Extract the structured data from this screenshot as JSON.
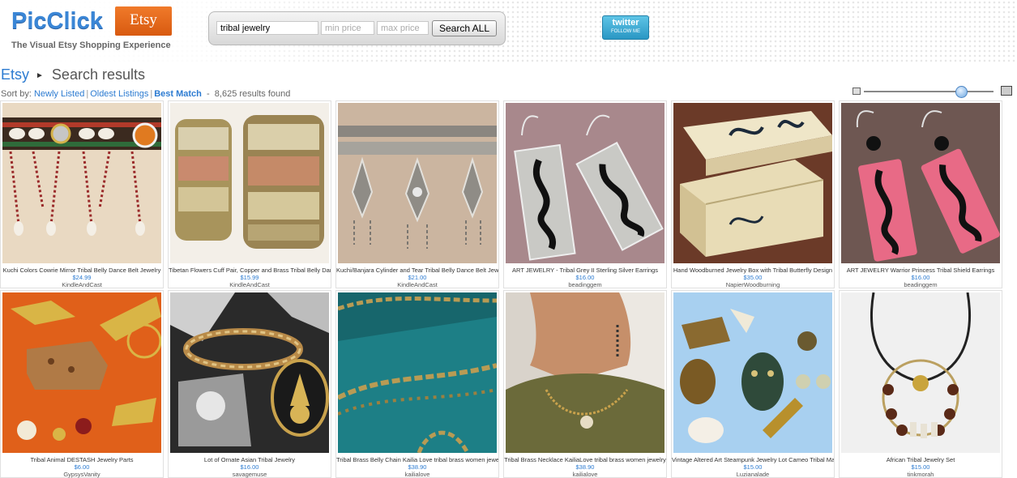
{
  "header": {
    "logo_text": "PicClick",
    "logo_badge": "Etsy",
    "tagline": "The Visual Etsy Shopping Experience",
    "twitter_top": "twitter",
    "twitter_bottom": "FOLLOW ME"
  },
  "search": {
    "query": "tribal jewelry",
    "min_price_placeholder": "min price",
    "max_price_placeholder": "max price",
    "button_label": "Search ALL"
  },
  "breadcrumb": {
    "root": "Etsy",
    "separator_icon": "triangle-right-icon",
    "current": "Search results"
  },
  "sort": {
    "label": "Sort by:",
    "newly_listed": "Newly Listed",
    "oldest_listings": "Oldest Listings",
    "best_match": "Best Match",
    "results": "8,625 results found"
  },
  "zoom": {
    "level": 0.72
  },
  "colors": {
    "link": "#2c7bd1",
    "brand_orange": "#e06a1a",
    "logo_blue": "#3a86d6"
  },
  "listings": [
    {
      "title": "Kuchi Colors Cowrie Mirror Tribal Belly Dance Belt Jewelry",
      "price": "$24.99",
      "shop": "KindleAndCast"
    },
    {
      "title": "Tibetan Flowers Cuff Pair, Copper and Brass Tribal Belly Dance",
      "price": "$15.99",
      "shop": "KindleAndCast"
    },
    {
      "title": "Kuchi/Banjara Cylinder and Tear Tribal Belly Dance Belt Jewelry",
      "price": "$21.00",
      "shop": "KindleAndCast"
    },
    {
      "title": "ART JEWELRY - Tribal Grey II Sterling Silver Earrings",
      "price": "$16.00",
      "shop": "beadinggem"
    },
    {
      "title": "Hand Woodburned Jewelry Box with Tribal Butterfly Design",
      "price": "$35.00",
      "shop": "NapierWoodburning"
    },
    {
      "title": "ART JEWELRY Warrior Princess Tribal Shield Earrings",
      "price": "$16.00",
      "shop": "beadinggem"
    },
    {
      "title": "Tribal Animal DESTASH Jewelry Parts",
      "price": "$6.00",
      "shop": "GypsysVanity"
    },
    {
      "title": "Lot of Ornate Asian Tribal Jewelry",
      "price": "$16.00",
      "shop": "savagemuse"
    },
    {
      "title": "Tribal Brass Belly Chain Kailia Love tribal brass women jewelry",
      "price": "$38.90",
      "shop": "kailialove"
    },
    {
      "title": "Tribal Brass Necklace KailiaLove tribal brass women jewelry",
      "price": "$38.90",
      "shop": "kailialove"
    },
    {
      "title": "Vintage Altered Art Steampunk Jewelry Lot Cameo Tribal Mask",
      "price": "$15.00",
      "shop": "Luzianalade"
    },
    {
      "title": "African Tribal Jewelry Set",
      "price": "$15.00",
      "shop": "tinkmorah"
    }
  ]
}
